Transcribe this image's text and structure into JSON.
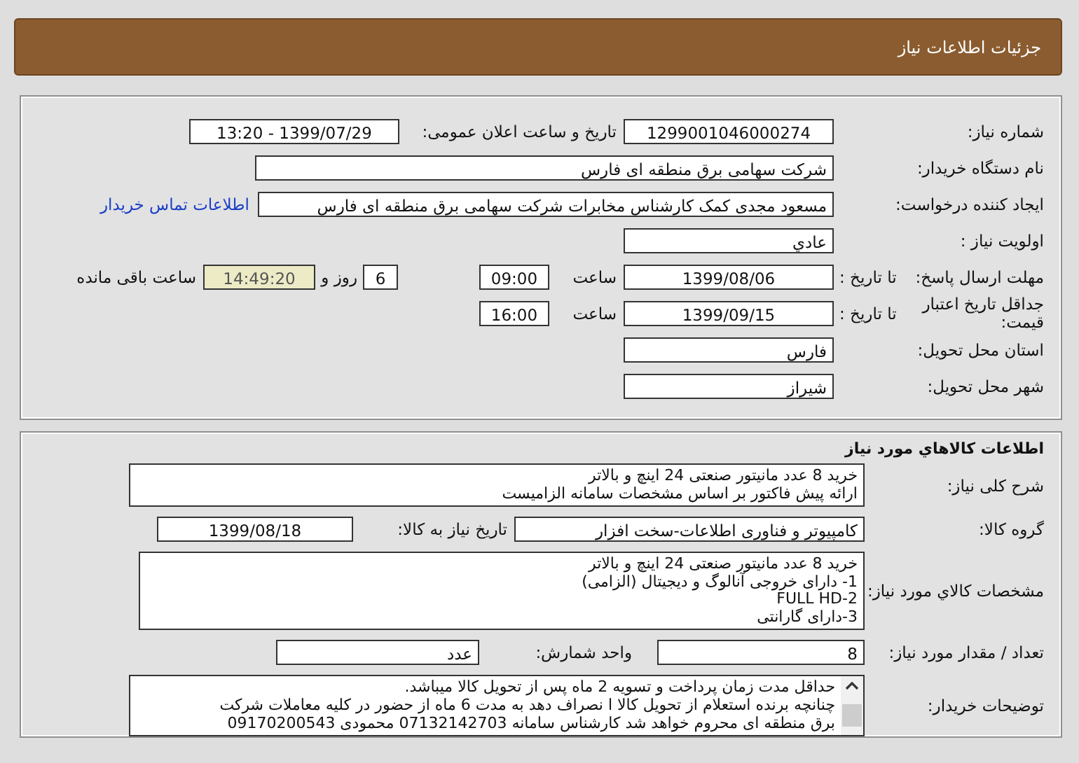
{
  "header": {
    "title": "جزئیات اطلاعات نیاز"
  },
  "need": {
    "number_label": "شماره نیاز:",
    "number": "1299001046000274",
    "announce_label": "تاریخ و ساعت اعلان عمومی:",
    "announce": "1399/07/29 - 13:20",
    "buyer_label": "نام دستگاه خریدار:",
    "buyer": "شرکت سهامی برق منطقه ای فارس",
    "creator_label": "ایجاد کننده درخواست:",
    "creator": "مسعود مجدی کمک کارشناس مخابرات شرکت سهامی برق منطقه ای فارس",
    "contact_link": "اطلاعات تماس خریدار",
    "priority_label": "اولویت نیاز :",
    "priority": "عادي",
    "deadline": {
      "label": "مهلت ارسال پاسخ:",
      "date_label": "تا تاریخ :",
      "date": "1399/08/06",
      "time_label": "ساعت",
      "time": "09:00",
      "days": "6",
      "days_label": "روز و",
      "remaining": "14:49:20",
      "remaining_label": "ساعت باقی مانده"
    },
    "validity": {
      "label": "جداقل تاریخ اعتبار قیمت:",
      "date_label": "تا تاریخ :",
      "date": "1399/09/15",
      "time_label": "ساعت",
      "time": "16:00"
    },
    "province_label": "استان محل تحویل:",
    "province": "فارس",
    "city_label": "شهر محل تحویل:",
    "city": "شیراز"
  },
  "goods": {
    "title": "اطلاعات کالاهاي مورد نیاز",
    "summary_label": "شرح کلی نیاز:",
    "summary": [
      "خرید 8 عدد مانیتور صنعتی 24 اینچ و بالاتر",
      "ارائه پیش فاکتور بر اساس مشخصات سامانه الزامیست"
    ],
    "group_label": "گروه کالا:",
    "group": "کامپیوتر و فناوری اطلاعات-سخت افزار",
    "need_date_label": "تاریخ نیاز به کالا:",
    "need_date": "1399/08/18",
    "specs_label": "مشخصات کالاي مورد نیاز:",
    "specs": [
      "خرید 8 عدد مانیتور صنعتی 24 اینچ و بالاتر",
      "1- دارای خروجی آنالوگ و دیجیتال (الزامی)",
      "2-FULL HD",
      "3-دارای گارانتی"
    ],
    "quantity_label": "تعداد / مقدار مورد نیاز:",
    "quantity": "8",
    "unit_label": "واحد شمارش:",
    "unit": "عدد",
    "notes_label": "توضیحات خریدار:",
    "notes": [
      "حداقل مدت زمان پرداخت و تسویه 2 ماه پس از تحویل کالا میباشد.",
      "چنانچه برنده استعلام از تحویل کالا ا نصراف دهد به مدت 6 ماه از حضور در کلیه معاملات شرکت",
      "برق منطقه ای محروم خواهد شد کارشناس سامانه 07132142703 محمودی 09170200543"
    ]
  }
}
